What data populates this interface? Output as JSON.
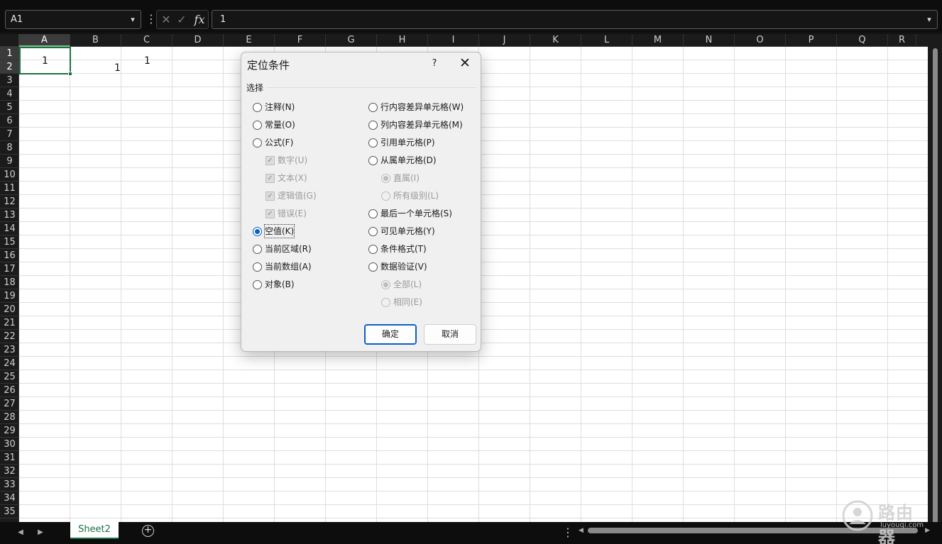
{
  "formula_bar": {
    "name_box": "A1",
    "fx_label": "fx",
    "formula_value": "1"
  },
  "columns": [
    "A",
    "B",
    "C",
    "D",
    "E",
    "F",
    "G",
    "H",
    "I",
    "J",
    "K",
    "L",
    "M",
    "N",
    "O",
    "P",
    "Q",
    "R"
  ],
  "rows": [
    "1",
    "2",
    "3",
    "4",
    "5",
    "6",
    "7",
    "8",
    "9",
    "10",
    "11",
    "12",
    "13",
    "14",
    "15",
    "16",
    "17",
    "18",
    "19",
    "20",
    "21",
    "22",
    "23",
    "24",
    "25",
    "26",
    "27",
    "28",
    "29",
    "30",
    "31",
    "32",
    "33",
    "34",
    "35"
  ],
  "cells": {
    "a1": "1",
    "b2": "1",
    "c1": "1"
  },
  "sheet_tabs": [
    "Sheet2"
  ],
  "dialog": {
    "title": "定位条件",
    "help": "?",
    "close": "✕",
    "group_label": "选择",
    "left_options": [
      {
        "label": "注释(N)",
        "type": "radio",
        "selected": false,
        "disabled": false
      },
      {
        "label": "常量(O)",
        "type": "radio",
        "selected": false,
        "disabled": false
      },
      {
        "label": "公式(F)",
        "type": "radio",
        "selected": false,
        "disabled": false
      },
      {
        "label": "数字(U)",
        "type": "checkbox",
        "checked": true,
        "disabled": true
      },
      {
        "label": "文本(X)",
        "type": "checkbox",
        "checked": true,
        "disabled": true
      },
      {
        "label": "逻辑值(G)",
        "type": "checkbox",
        "checked": true,
        "disabled": true
      },
      {
        "label": "错误(E)",
        "type": "checkbox",
        "checked": true,
        "disabled": true
      },
      {
        "label": "空值(K)",
        "type": "radio",
        "selected": true,
        "disabled": false
      },
      {
        "label": "当前区域(R)",
        "type": "radio",
        "selected": false,
        "disabled": false
      },
      {
        "label": "当前数组(A)",
        "type": "radio",
        "selected": false,
        "disabled": false
      },
      {
        "label": "对象(B)",
        "type": "radio",
        "selected": false,
        "disabled": false
      }
    ],
    "right_options": [
      {
        "label": "行内容差异单元格(W)",
        "type": "radio",
        "selected": false,
        "disabled": false
      },
      {
        "label": "列内容差异单元格(M)",
        "type": "radio",
        "selected": false,
        "disabled": false
      },
      {
        "label": "引用单元格(P)",
        "type": "radio",
        "selected": false,
        "disabled": false
      },
      {
        "label": "从属单元格(D)",
        "type": "radio",
        "selected": false,
        "disabled": false
      },
      {
        "label": "直属(I)",
        "type": "radio",
        "selected": true,
        "disabled": true
      },
      {
        "label": "所有级别(L)",
        "type": "radio",
        "selected": false,
        "disabled": true
      },
      {
        "label": "最后一个单元格(S)",
        "type": "radio",
        "selected": false,
        "disabled": false
      },
      {
        "label": "可见单元格(Y)",
        "type": "radio",
        "selected": false,
        "disabled": false
      },
      {
        "label": "条件格式(T)",
        "type": "radio",
        "selected": false,
        "disabled": false
      },
      {
        "label": "数据验证(V)",
        "type": "radio",
        "selected": false,
        "disabled": false
      },
      {
        "label": "全部(L)",
        "type": "radio",
        "selected": true,
        "disabled": true
      },
      {
        "label": "相同(E)",
        "type": "radio",
        "selected": false,
        "disabled": true
      }
    ],
    "ok_label": "确定",
    "cancel_label": "取消"
  },
  "watermark": {
    "text": "路由器",
    "sub": "luyouqi.com"
  },
  "colors": {
    "accent_green": "#1e7145",
    "accent_blue": "#0a5fc8"
  }
}
